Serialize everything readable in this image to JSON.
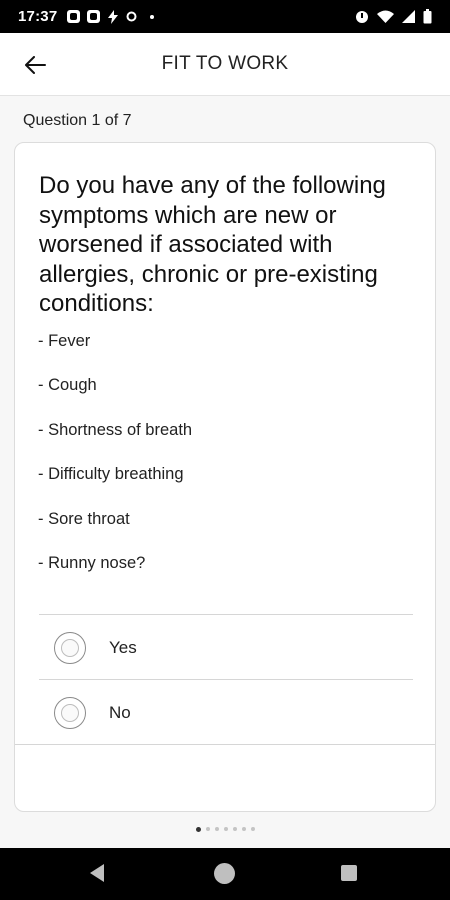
{
  "status_bar": {
    "time": "17:37",
    "icons": [
      "notification-square-icon",
      "notification-square-icon",
      "lightning-icon",
      "circle-icon",
      "dot-icon",
      "alarm-icon",
      "wifi-icon",
      "signal-icon",
      "battery-icon"
    ]
  },
  "app_bar": {
    "back_icon": "arrow-left-icon",
    "title": "FIT TO WORK"
  },
  "question": {
    "counter": "Question 1 of 7",
    "text": "Do you have any of the following symptoms which are new or worsened if associated with allergies, chronic or pre-existing conditions:",
    "symptoms": [
      "- Fever",
      "- Cough",
      "- Shortness of breath",
      "- Difficulty breathing",
      "- Sore throat",
      "- Runny nose?"
    ],
    "options": [
      {
        "label": "Yes",
        "selected": false
      },
      {
        "label": "No",
        "selected": false
      }
    ]
  },
  "pager": {
    "total_pages": 7,
    "current_page": 1
  },
  "nav_bar": {
    "icons": [
      "back-triangle-icon",
      "home-circle-icon",
      "recents-square-icon"
    ]
  }
}
